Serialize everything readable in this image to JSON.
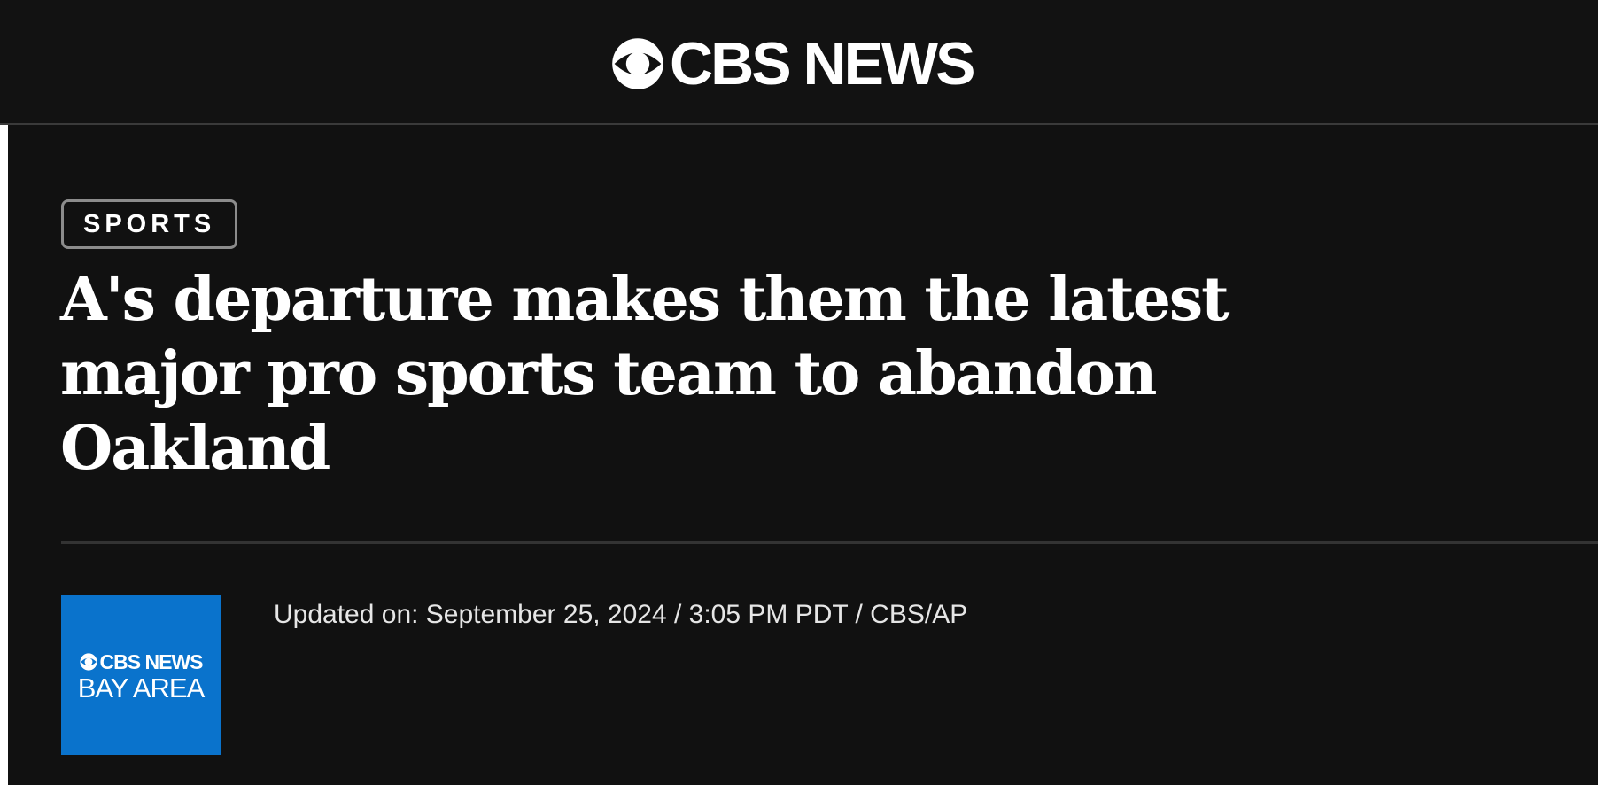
{
  "header": {
    "brand_name": "CBS NEWS",
    "brand_icon": "cbs-eye-icon"
  },
  "article": {
    "section": "SPORTS",
    "headline": "A's departure makes them the latest major pro sports team to abandon Oakland",
    "meta": "Updated on: September 25, 2024 / 3:05 PM PDT / CBS/AP"
  },
  "byline_logo": {
    "line1": "CBS NEWS",
    "line2": "BAY AREA",
    "icon": "cbs-eye-icon"
  },
  "colors": {
    "background": "#111111",
    "text": "#ffffff",
    "tag_border": "#8c8c8c",
    "divider": "#333333",
    "station_blue": "#0a73cc"
  }
}
